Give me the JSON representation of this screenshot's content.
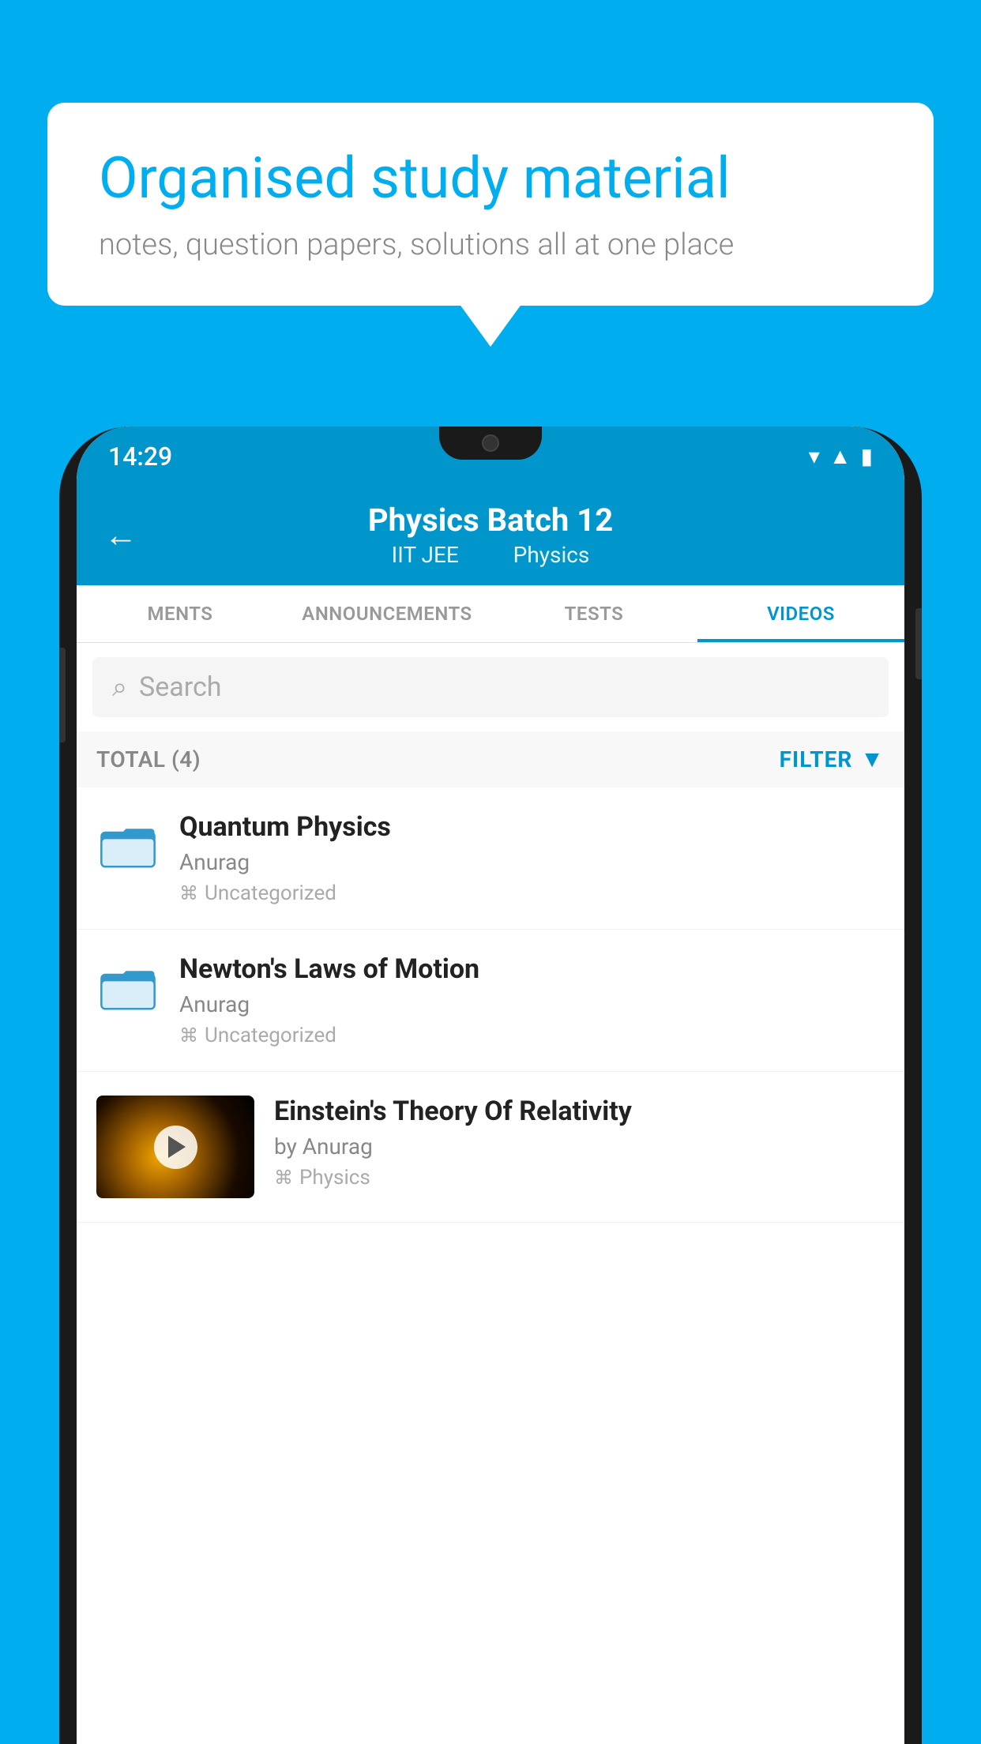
{
  "background_color": "#00AEEF",
  "speech_bubble": {
    "title": "Organised study material",
    "subtitle": "notes, question papers, solutions all at one place"
  },
  "phone": {
    "status_bar": {
      "time": "14:29",
      "icons": [
        "wifi",
        "signal",
        "battery"
      ]
    },
    "header": {
      "title": "Physics Batch 12",
      "subtitle_part1": "IIT JEE",
      "subtitle_part2": "Physics",
      "back_label": "←"
    },
    "tabs": [
      {
        "label": "MENTS",
        "active": false
      },
      {
        "label": "ANNOUNCEMENTS",
        "active": false
      },
      {
        "label": "TESTS",
        "active": false
      },
      {
        "label": "VIDEOS",
        "active": true
      }
    ],
    "search": {
      "placeholder": "Search"
    },
    "filter_bar": {
      "total_label": "TOTAL (4)",
      "filter_label": "FILTER"
    },
    "videos": [
      {
        "id": 1,
        "title": "Quantum Physics",
        "author": "Anurag",
        "tag": "Uncategorized",
        "type": "folder",
        "has_thumbnail": false
      },
      {
        "id": 2,
        "title": "Newton's Laws of Motion",
        "author": "Anurag",
        "tag": "Uncategorized",
        "type": "folder",
        "has_thumbnail": false
      },
      {
        "id": 3,
        "title": "Einstein's Theory Of Relativity",
        "author": "by Anurag",
        "tag": "Physics",
        "type": "video",
        "has_thumbnail": true
      }
    ]
  }
}
